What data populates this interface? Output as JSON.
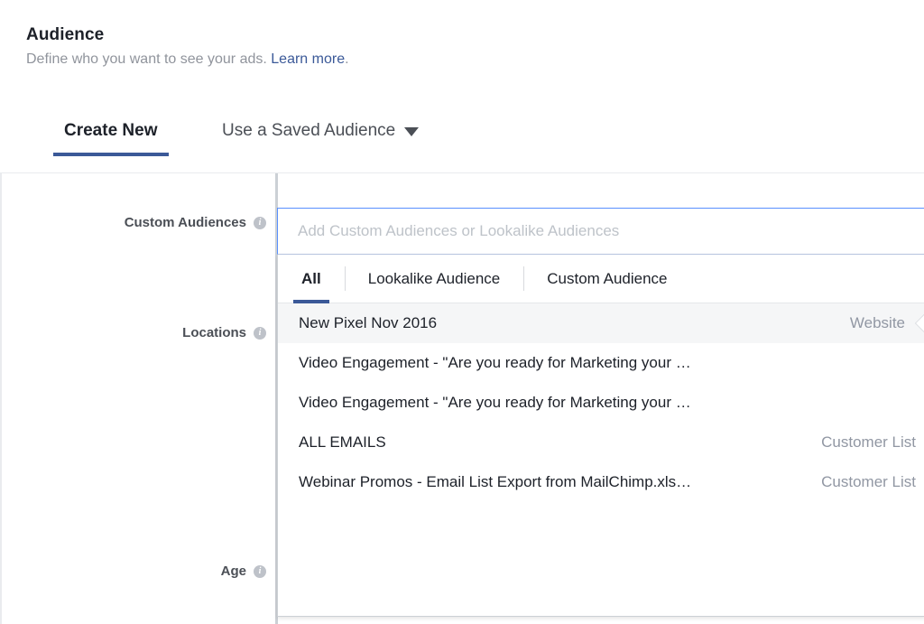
{
  "header": {
    "title": "Audience",
    "subtitle_text": "Define who you want to see your ads.",
    "learn_more": "Learn more",
    "period": "."
  },
  "top_tabs": [
    {
      "label": "Create New",
      "active": true
    },
    {
      "label": "Use a Saved Audience",
      "active": false,
      "caret": "caret-down-icon"
    }
  ],
  "fields": {
    "custom_audiences_label": "Custom Audiences",
    "locations_label": "Locations",
    "age_label": "Age",
    "info_glyph": "i"
  },
  "combobox": {
    "placeholder": "Add Custom Audiences or Lookalike Audiences",
    "value": ""
  },
  "dropdown": {
    "tabs": [
      {
        "label": "All",
        "active": true
      },
      {
        "label": "Lookalike Audience",
        "active": false
      },
      {
        "label": "Custom Audience",
        "active": false
      }
    ],
    "rows": [
      {
        "name": "New Pixel Nov 2016",
        "type": "Website",
        "highlighted": true
      },
      {
        "name": "Video Engagement - \"Are you ready for Marketing your …",
        "type": "",
        "highlighted": false
      },
      {
        "name": "Video Engagement - \"Are you ready for Marketing your …",
        "type": "",
        "highlighted": false
      },
      {
        "name": "ALL EMAILS",
        "type": "Customer List",
        "highlighted": false
      },
      {
        "name": "Webinar Promos - Email List Export from MailChimp.xls…",
        "type": "Customer List",
        "highlighted": false
      }
    ]
  },
  "colors": {
    "accent_blue": "#3b5998",
    "link_blue": "#3b5998",
    "focus_border": "#5890ff",
    "muted_text": "#90949c",
    "label_text": "#4b4f56",
    "row_highlight": "#f5f6f7",
    "border": "#ccd0d5"
  }
}
